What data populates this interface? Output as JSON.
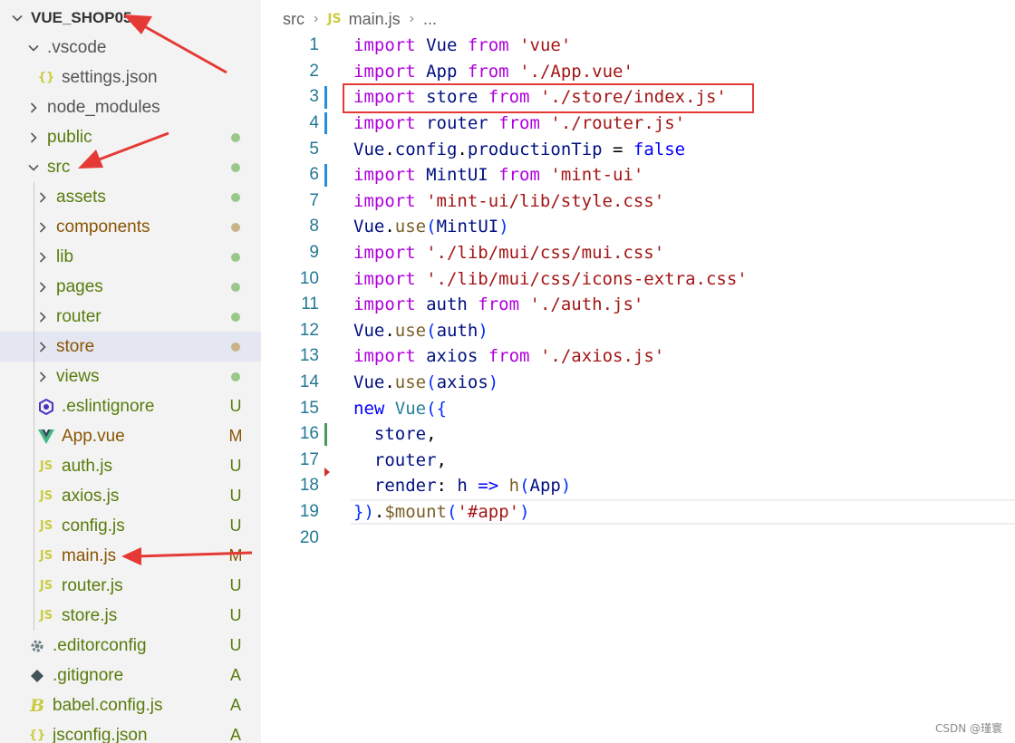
{
  "explorer": {
    "items": [
      {
        "label": "VUE_SHOP05",
        "kind": "root",
        "chevron": "down",
        "depth": 0,
        "icon": "",
        "decoration": ""
      },
      {
        "label": ".vscode",
        "kind": "folder",
        "chevron": "down",
        "depth": 1,
        "icon": "",
        "decoration": ""
      },
      {
        "label": "settings.json",
        "kind": "file",
        "chevron": "",
        "depth": 2,
        "icon": "{}",
        "decoration": ""
      },
      {
        "label": "node_modules",
        "kind": "folder",
        "chevron": "right",
        "depth": 1,
        "icon": "",
        "decoration": ""
      },
      {
        "label": "public",
        "kind": "folder",
        "chevron": "right",
        "depth": 1,
        "icon": "",
        "decoration": "dot",
        "status": "added"
      },
      {
        "label": "src",
        "kind": "folder",
        "chevron": "down",
        "depth": 1,
        "icon": "",
        "decoration": "dot",
        "status": "added"
      },
      {
        "label": "assets",
        "kind": "folder",
        "chevron": "right",
        "depth": 2,
        "icon": "",
        "decoration": "dot",
        "status": "added"
      },
      {
        "label": "components",
        "kind": "folder",
        "chevron": "right",
        "depth": 2,
        "icon": "",
        "decoration": "dot",
        "status": "modified"
      },
      {
        "label": "lib",
        "kind": "folder",
        "chevron": "right",
        "depth": 2,
        "icon": "",
        "decoration": "dot",
        "status": "added"
      },
      {
        "label": "pages",
        "kind": "folder",
        "chevron": "right",
        "depth": 2,
        "icon": "",
        "decoration": "dot",
        "status": "added"
      },
      {
        "label": "router",
        "kind": "folder",
        "chevron": "right",
        "depth": 2,
        "icon": "",
        "decoration": "dot",
        "status": "added"
      },
      {
        "label": "store",
        "kind": "folder",
        "chevron": "right",
        "depth": 2,
        "icon": "",
        "decoration": "dot",
        "status": "modified",
        "selected": true
      },
      {
        "label": "views",
        "kind": "folder",
        "chevron": "right",
        "depth": 2,
        "icon": "",
        "decoration": "dot",
        "status": "added"
      },
      {
        "label": ".eslintignore",
        "kind": "file",
        "chevron": "",
        "depth": 2,
        "icon": "eslint",
        "decoration": "U",
        "status": "added"
      },
      {
        "label": "App.vue",
        "kind": "file",
        "chevron": "",
        "depth": 2,
        "icon": "vue",
        "decoration": "M",
        "status": "modified"
      },
      {
        "label": "auth.js",
        "kind": "file",
        "chevron": "",
        "depth": 2,
        "icon": "JS",
        "decoration": "U",
        "status": "added"
      },
      {
        "label": "axios.js",
        "kind": "file",
        "chevron": "",
        "depth": 2,
        "icon": "JS",
        "decoration": "U",
        "status": "added"
      },
      {
        "label": "config.js",
        "kind": "file",
        "chevron": "",
        "depth": 2,
        "icon": "JS",
        "decoration": "U",
        "status": "added"
      },
      {
        "label": "main.js",
        "kind": "file",
        "chevron": "",
        "depth": 2,
        "icon": "JS",
        "decoration": "M",
        "status": "modified"
      },
      {
        "label": "router.js",
        "kind": "file",
        "chevron": "",
        "depth": 2,
        "icon": "JS",
        "decoration": "U",
        "status": "added"
      },
      {
        "label": "store.js",
        "kind": "file",
        "chevron": "",
        "depth": 2,
        "icon": "JS",
        "decoration": "U",
        "status": "added"
      },
      {
        "label": ".editorconfig",
        "kind": "file",
        "chevron": "",
        "depth": 1,
        "icon": "gear",
        "decoration": "U",
        "status": "added"
      },
      {
        "label": ".gitignore",
        "kind": "file",
        "chevron": "",
        "depth": 1,
        "icon": "git",
        "decoration": "A",
        "status": "added"
      },
      {
        "label": "babel.config.js",
        "kind": "file",
        "chevron": "",
        "depth": 1,
        "icon": "babel",
        "decoration": "A",
        "status": "added"
      },
      {
        "label": "jsconfig.json",
        "kind": "file",
        "chevron": "",
        "depth": 1,
        "icon": "{}",
        "decoration": "A",
        "status": "added"
      }
    ]
  },
  "breadcrumb": {
    "folder": "src",
    "file_badge": "JS",
    "file": "main.js",
    "ellipsis": "..."
  },
  "editor": {
    "current_line": 19,
    "highlighted_line": 3,
    "lines": [
      {
        "n": "1",
        "tokens": [
          [
            "import",
            "kw"
          ],
          [
            " Vue ",
            "pl"
          ],
          [
            "from",
            "kw"
          ],
          [
            " ",
            "pl"
          ],
          [
            "'vue'",
            "str"
          ]
        ]
      },
      {
        "n": "2",
        "tokens": [
          [
            "import",
            "kw"
          ],
          [
            " App ",
            "pl"
          ],
          [
            "from",
            "kw"
          ],
          [
            " ",
            "pl"
          ],
          [
            "'./App.vue'",
            "str"
          ]
        ]
      },
      {
        "n": "3",
        "tokens": [
          [
            "import",
            "kw"
          ],
          [
            " store ",
            "pl"
          ],
          [
            "from",
            "kw"
          ],
          [
            " ",
            "pl"
          ],
          [
            "'./store/index.js'",
            "str"
          ]
        ],
        "gutter": "modified"
      },
      {
        "n": "4",
        "tokens": [
          [
            "import",
            "kw"
          ],
          [
            " router ",
            "pl"
          ],
          [
            "from",
            "kw"
          ],
          [
            " ",
            "pl"
          ],
          [
            "'./router.js'",
            "str"
          ]
        ],
        "gutter": "modified"
      },
      {
        "n": "5",
        "tokens": [
          [
            "Vue",
            "pl"
          ],
          [
            ".",
            "pc"
          ],
          [
            "config",
            "pl"
          ],
          [
            ".",
            "pc"
          ],
          [
            "productionTip",
            "pl"
          ],
          [
            " = ",
            "pc"
          ],
          [
            "false",
            "decl"
          ]
        ]
      },
      {
        "n": "6",
        "tokens": [
          [
            "import",
            "kw"
          ],
          [
            " MintUI ",
            "pl"
          ],
          [
            "from",
            "kw"
          ],
          [
            " ",
            "pl"
          ],
          [
            "'mint-ui'",
            "str"
          ]
        ],
        "gutter": "modified"
      },
      {
        "n": "7",
        "tokens": [
          [
            "import",
            "kw"
          ],
          [
            " ",
            "pl"
          ],
          [
            "'mint-ui/lib/style.css'",
            "str"
          ]
        ]
      },
      {
        "n": "8",
        "tokens": [
          [
            "Vue",
            "pl"
          ],
          [
            ".",
            "pc"
          ],
          [
            "use",
            "fn"
          ],
          [
            "(",
            "brace"
          ],
          [
            "MintUI",
            "pl"
          ],
          [
            ")",
            "brace"
          ]
        ]
      },
      {
        "n": "9",
        "tokens": [
          [
            "import",
            "kw"
          ],
          [
            " ",
            "pl"
          ],
          [
            "'./lib/mui/css/mui.css'",
            "str"
          ]
        ]
      },
      {
        "n": "10",
        "tokens": [
          [
            "import",
            "kw"
          ],
          [
            " ",
            "pl"
          ],
          [
            "'./lib/mui/css/icons-extra.css'",
            "str"
          ]
        ]
      },
      {
        "n": "11",
        "tokens": [
          [
            "import",
            "kw"
          ],
          [
            " auth ",
            "pl"
          ],
          [
            "from",
            "kw"
          ],
          [
            " ",
            "pl"
          ],
          [
            "'./auth.js'",
            "str"
          ]
        ]
      },
      {
        "n": "12",
        "tokens": [
          [
            "Vue",
            "pl"
          ],
          [
            ".",
            "pc"
          ],
          [
            "use",
            "fn"
          ],
          [
            "(",
            "brace"
          ],
          [
            "auth",
            "pl"
          ],
          [
            ")",
            "brace"
          ]
        ]
      },
      {
        "n": "13",
        "tokens": [
          [
            "import",
            "kw"
          ],
          [
            " axios ",
            "pl"
          ],
          [
            "from",
            "kw"
          ],
          [
            " ",
            "pl"
          ],
          [
            "'./axios.js'",
            "str"
          ]
        ]
      },
      {
        "n": "14",
        "tokens": [
          [
            "Vue",
            "pl"
          ],
          [
            ".",
            "pc"
          ],
          [
            "use",
            "fn"
          ],
          [
            "(",
            "brace"
          ],
          [
            "axios",
            "pl"
          ],
          [
            ")",
            "brace"
          ]
        ]
      },
      {
        "n": "15",
        "tokens": [
          [
            "new",
            "decl"
          ],
          [
            " ",
            "pl"
          ],
          [
            "Vue",
            "cls"
          ],
          [
            "(",
            "brace"
          ],
          [
            "{",
            "brace"
          ]
        ]
      },
      {
        "n": "16",
        "tokens": [
          [
            "  store",
            "pl"
          ],
          [
            ",",
            "pc"
          ]
        ],
        "gutter": "added"
      },
      {
        "n": "17",
        "tokens": [
          [
            "  router",
            "pl"
          ],
          [
            ",",
            "pc"
          ]
        ]
      },
      {
        "n": "18",
        "tokens": [
          [
            "  render",
            "pl"
          ],
          [
            ": ",
            "pc"
          ],
          [
            "h",
            "pl"
          ],
          [
            " => ",
            "decl"
          ],
          [
            "h",
            "fn"
          ],
          [
            "(",
            "brace"
          ],
          [
            "App",
            "pl"
          ],
          [
            ")",
            "brace"
          ]
        ],
        "gutter": "deleted"
      },
      {
        "n": "19",
        "tokens": [
          [
            "}",
            "brace"
          ],
          [
            ")",
            "brace"
          ],
          [
            ".",
            "pc"
          ],
          [
            "$mount",
            "fn"
          ],
          [
            "(",
            "brace"
          ],
          [
            "'#app'",
            "str"
          ],
          [
            ")",
            "brace"
          ]
        ]
      },
      {
        "n": "20",
        "tokens": []
      }
    ]
  },
  "colors": {
    "highlight_box": "#e53935",
    "annotation_arrow": "#e53935"
  },
  "watermark": "CSDN @瑾寰"
}
